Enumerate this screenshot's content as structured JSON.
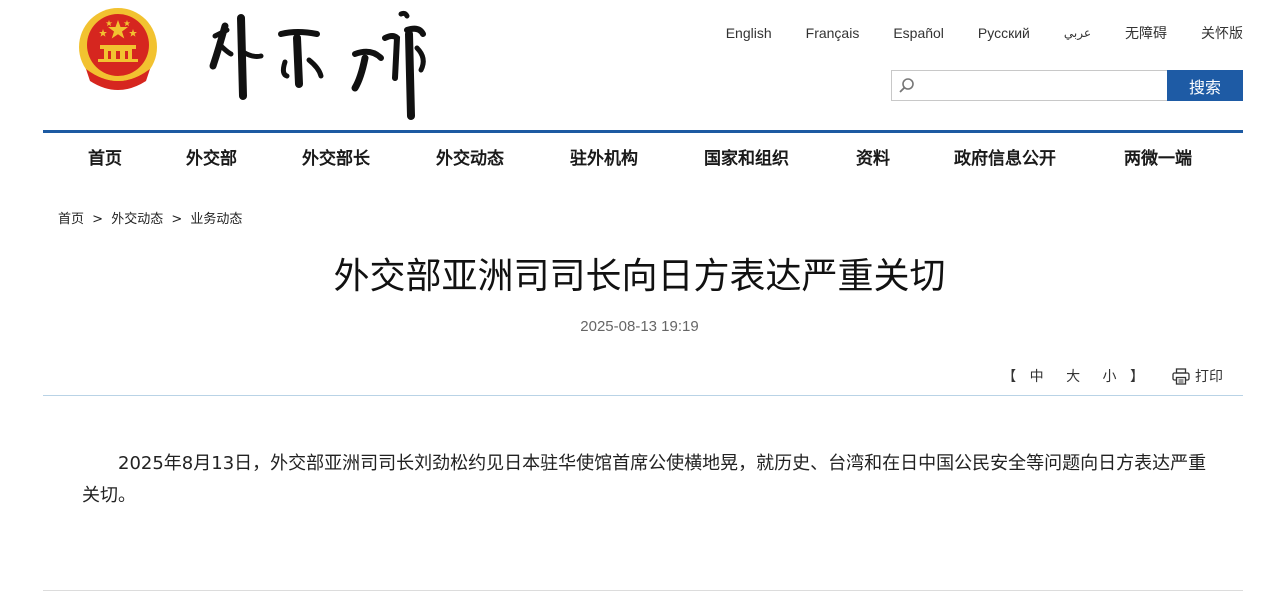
{
  "header": {
    "languages": [
      "English",
      "Français",
      "Español",
      "Русский",
      "عربي",
      "无障碍",
      "关怀版"
    ],
    "search": {
      "value": "",
      "placeholder": "",
      "button_label": "搜索"
    }
  },
  "nav": {
    "items": [
      "首页",
      "外交部",
      "外交部长",
      "外交动态",
      "驻外机构",
      "国家和组织",
      "资料",
      "政府信息公开",
      "两微一端"
    ]
  },
  "breadcrumb": {
    "items": [
      "首页",
      "外交动态",
      "业务动态"
    ],
    "separator": ">"
  },
  "article": {
    "title": "外交部亚洲司司长向日方表达严重关切",
    "date": "2025-08-13 19:19",
    "font_size_open": "【",
    "font_size_options": [
      "中",
      "大",
      "小"
    ],
    "font_size_close": "】",
    "print_label": "打印",
    "body": "2025年8月13日，外交部亚洲司司长刘劲松约见日本驻华使馆首席公使横地晃，就历史、台湾和在日中国公民安全等问题向日方表达严重关切。"
  },
  "colors": {
    "accent": "#1d5aa2",
    "emblem_red": "#d6261f",
    "emblem_gold": "#f2c230"
  }
}
